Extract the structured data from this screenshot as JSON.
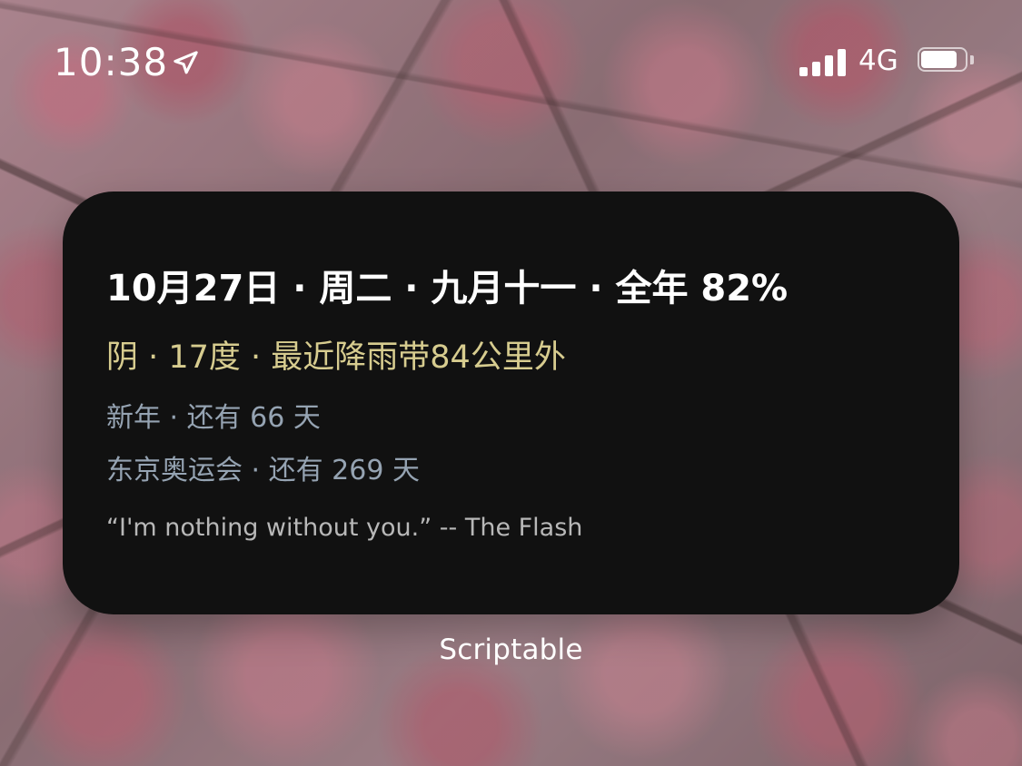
{
  "status_bar": {
    "time": "10:38",
    "network": "4G",
    "battery_level_percent": 90,
    "icons": {
      "location": "location-arrow-icon",
      "signal": "cellular-signal-icon",
      "battery": "battery-icon"
    }
  },
  "widget": {
    "date_line": "10月27日 · 周二 · 九月十一 · 全年 82%",
    "weather_line": "阴 · 17度 · 最近降雨带84公里外",
    "countdown_1": "新年 · 还有 66 天",
    "countdown_2": "东京奥运会 · 还有 269 天",
    "quote": "“I'm nothing without you.” -- The Flash",
    "background_color": "#111111",
    "colors": {
      "date": "#ffffff",
      "weather": "#d7cc8f",
      "countdowns": "#95a3b2",
      "quote": "#b8b8b8"
    }
  },
  "app_label": "Scriptable"
}
